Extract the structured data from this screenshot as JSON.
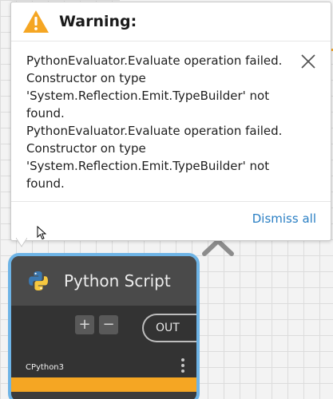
{
  "popup": {
    "title": "Warning:",
    "message_lines": [
      "PythonEvaluator.Evaluate operation failed.",
      "Constructor on type",
      "'System.Reflection.Emit.TypeBuilder' not",
      "found.",
      "PythonEvaluator.Evaluate operation failed.",
      "Constructor on type",
      "'System.Reflection.Emit.TypeBuilder' not",
      "found."
    ],
    "dismiss_label": "Dismiss all",
    "icons": {
      "warning": "warning-triangle-icon",
      "close": "close-icon"
    }
  },
  "node": {
    "title": "Python Script",
    "add_port_label": "+",
    "remove_port_label": "−",
    "output_port_label": "OUT",
    "engine": "CPython3",
    "icons": {
      "python": "python-logo-icon",
      "more": "more-vertical-icon"
    }
  },
  "colors": {
    "warning": "#f5a623",
    "node_selected_border": "#6eb4e6",
    "node_status_bar": "#f5a623",
    "link": "#2a7fc4"
  }
}
